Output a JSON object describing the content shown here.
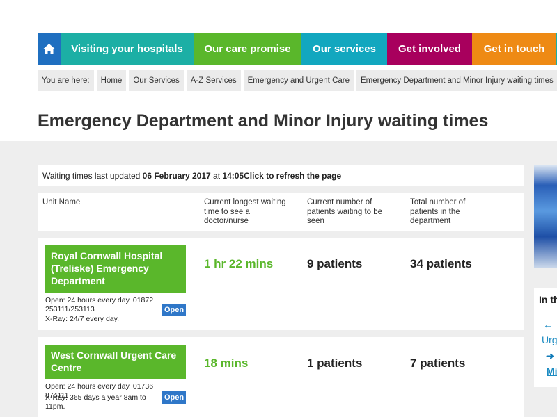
{
  "nav": {
    "home_icon": "home-icon",
    "items": [
      "Visiting your hospitals",
      "Our care promise",
      "Our services",
      "Get involved",
      "Get in touch"
    ],
    "colors": [
      "#1cafa5",
      "#5ab72b",
      "#12a7bf",
      "#a8005d",
      "#ee8a14"
    ]
  },
  "breadcrumb": [
    "You are here:",
    "Home",
    "Our Services",
    "A-Z Services",
    "Emergency and Urgent Care",
    "Emergency Department and Minor Injury waiting times"
  ],
  "page_title": "Emergency Department and Minor Injury waiting times",
  "updated": {
    "prefix": "Waiting times last updated ",
    "date": "06 February 2017",
    "at": " at ",
    "time": "14:05",
    "refresh": " Click to refresh the page"
  },
  "table": {
    "headers": [
      "Unit Name",
      "Current longest waiting time to see a doctor/nurse",
      "Current number of patients waiting to be seen",
      "Total number of patients in the department"
    ],
    "units": [
      {
        "name": "Royal Cornwall Hospital (Treliske) Emergency Department",
        "open_hours": "Open: 24 hours every day. 01872 253111/253113",
        "xray": "X-Ray: 24/7 every day.",
        "status": "Open",
        "wait_time": "1 hr 22 mins",
        "waiting": "9 patients",
        "total": "34 patients"
      },
      {
        "name": "West Cornwall Urgent Care Centre",
        "open_hours": "Open: 24 hours every day. 01736 874111",
        "xray": "X-Ray: 365 days a year 8am to 11pm.",
        "status": "Open",
        "wait_time": "18 mins",
        "waiting": "1 patients",
        "total": "7 patients"
      }
    ]
  },
  "sidebar": {
    "heading": "In th",
    "link1_arrow": "←",
    "link1_text": "Urg",
    "link2_arrow": "➜",
    "link2_text": "Mi"
  }
}
